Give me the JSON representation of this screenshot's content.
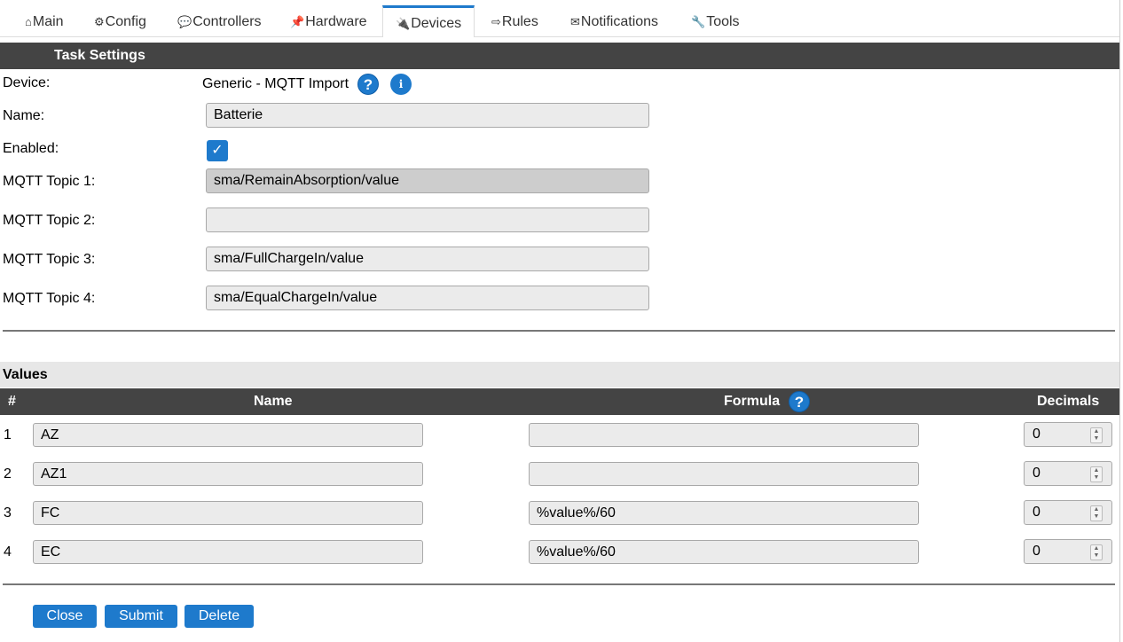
{
  "tabs": [
    {
      "icon": "⌂",
      "label": "Main"
    },
    {
      "icon": "⚙",
      "label": "Config"
    },
    {
      "icon": "💬",
      "label": "Controllers"
    },
    {
      "icon": "📌",
      "label": "Hardware"
    },
    {
      "icon": "🔌",
      "label": "Devices"
    },
    {
      "icon": "⇨",
      "label": "Rules"
    },
    {
      "icon": "✉",
      "label": "Notifications"
    },
    {
      "icon": "🔧",
      "label": "Tools"
    }
  ],
  "active_tab": "Devices",
  "task_settings": {
    "title": "Task Settings",
    "device_label": "Device:",
    "device_value": "Generic - MQTT Import",
    "name_label": "Name:",
    "name_value": "Batterie",
    "enabled_label": "Enabled:",
    "enabled": true,
    "topics": [
      {
        "label": "MQTT Topic 1:",
        "value": "sma/RemainAbsorption/value"
      },
      {
        "label": "MQTT Topic 2:",
        "value": ""
      },
      {
        "label": "MQTT Topic 3:",
        "value": "sma/FullChargeIn/value"
      },
      {
        "label": "MQTT Topic 4:",
        "value": "sma/EqualChargeIn/value"
      }
    ]
  },
  "values": {
    "title": "Values",
    "headers": {
      "num": "#",
      "name": "Name",
      "formula": "Formula",
      "decimals": "Decimals"
    },
    "rows": [
      {
        "num": "1",
        "name": "AZ",
        "formula": "",
        "decimals": "0"
      },
      {
        "num": "2",
        "name": "AZ1",
        "formula": "",
        "decimals": "0"
      },
      {
        "num": "3",
        "name": "FC",
        "formula": "%value%/60",
        "decimals": "0"
      },
      {
        "num": "4",
        "name": "EC",
        "formula": "%value%/60",
        "decimals": "0"
      }
    ]
  },
  "buttons": {
    "close": "Close",
    "submit": "Submit",
    "delete": "Delete"
  },
  "help_glyph": "?",
  "info_glyph": "i",
  "checkmark": "✓",
  "colors": {
    "accent": "#1e7acc",
    "header_bg": "#444444"
  }
}
